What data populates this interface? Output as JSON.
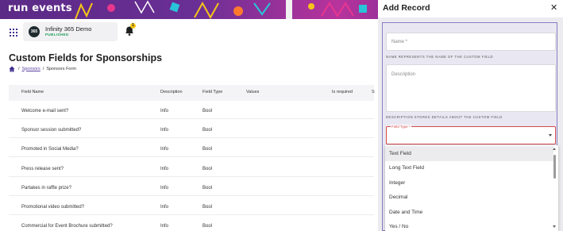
{
  "app": {
    "logo_text": "run events",
    "organization": {
      "avatar": "365",
      "name": "Infinity 365 Demo",
      "status": "PUBLISHED"
    },
    "notifications_count": "1"
  },
  "page": {
    "title": "Custom Fields for Sponsorships",
    "breadcrumb": {
      "link": "Sponsors",
      "separator": "/",
      "current": "Sponsors Form"
    }
  },
  "table": {
    "headers": [
      "Field Name",
      "Description",
      "Field Type",
      "Values",
      "Is required",
      "S"
    ],
    "rows": [
      {
        "name": "Welcome e-mail sent?",
        "description": "Info",
        "type": "Bool"
      },
      {
        "name": "Sponsor session submitted?",
        "description": "Info",
        "type": "Bool"
      },
      {
        "name": "Promoted in Social Media?",
        "description": "Info",
        "type": "Bool"
      },
      {
        "name": "Press release sent?",
        "description": "Info",
        "type": "Bool"
      },
      {
        "name": "Partakes in raffle prize?",
        "description": "Info",
        "type": "Bool"
      },
      {
        "name": "Promotional video submitted?",
        "description": "Info",
        "type": "Bool"
      },
      {
        "name": "Commercial for Event Brochure submitted?",
        "description": "Info",
        "type": "Bool"
      }
    ]
  },
  "drawer": {
    "title": "Add Record",
    "close_icon": "close-icon",
    "name_placeholder": "Name *",
    "name_hint": "NAME REPRESENTS THE NAME OF THE CUSTOM FIELD",
    "description_placeholder": "Description",
    "description_hint": "DESCRIPTION STORES DETAILS ABOUT THE CUSTOM FIELD",
    "field_type_label": "Field Type *",
    "field_type_value": "",
    "options": [
      "Text Field",
      "Long Text Field",
      "Integer",
      "Decimal",
      "Date and Time",
      "Yes / No"
    ]
  },
  "colors": {
    "accent": "#5b2a86",
    "error": "#d44a4a",
    "published": "#1a9b5a"
  }
}
